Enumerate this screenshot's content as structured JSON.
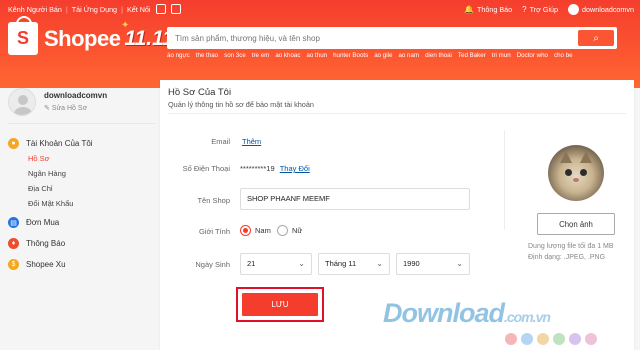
{
  "topbar": {
    "seller": "Kênh Người Bán",
    "app": "Tải Ứng Dụng",
    "connect": "Kết Nối",
    "notifications": "Thông Báo",
    "help": "Trợ Giúp",
    "account": "downloadcomvn"
  },
  "brand": {
    "name": "Shopee",
    "sale": "11.11"
  },
  "search": {
    "placeholder": "Tìm sản phẩm, thương hiệu, và tên shop",
    "keywords": [
      "áo ngực",
      "the thao",
      "son 3ce",
      "tre em",
      "ao khoac",
      "ao thun",
      "hunter Boots",
      "ao gile",
      "ao nam",
      "dien thoai",
      "Ted Baker",
      "tri mun",
      "Doctor who",
      "cho be"
    ]
  },
  "sidebar": {
    "username": "downloadcomvn",
    "edit_profile": "Sửa Hồ Sơ",
    "account_section": "Tài Khoản Của Tôi",
    "sub_items": [
      "Hồ Sơ",
      "Ngân Hàng",
      "Địa Chỉ",
      "Đổi Mật Khẩu"
    ],
    "orders": "Đơn Mua",
    "notifications": "Thông Báo",
    "shopee_coins": "Shopee Xu"
  },
  "profile": {
    "title": "Hồ Sơ Của Tôi",
    "subtitle": "Quản lý thông tin hồ sơ để bảo mật tài khoản",
    "email_label": "Email",
    "email_link": "Thêm",
    "phone_label": "Số Điện Thoại",
    "phone_value": "*********19",
    "phone_link": "Thay Đổi",
    "shop_label": "Tên Shop",
    "shop_value": "SHOP PHAANF MEEMF",
    "gender_label": "Giới Tính",
    "gender_male": "Nam",
    "gender_female": "Nữ",
    "dob_label": "Ngày Sinh",
    "dob_day": "21",
    "dob_month": "Tháng 11",
    "dob_year": "1990",
    "save": "LƯU",
    "choose_image": "Chọn ảnh",
    "size_hint": "Dung lượng file tối đa 1 MB",
    "format_hint": "Định dạng: .JPEG, .PNG"
  },
  "watermark": {
    "text": "Download",
    "domain": ".com.vn"
  },
  "colors": {
    "brand": "#f53d2d",
    "link": "#0055aa"
  }
}
